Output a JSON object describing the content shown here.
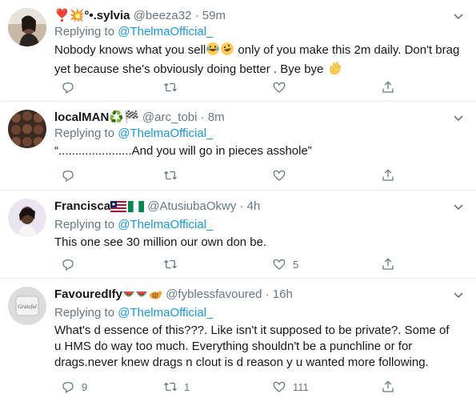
{
  "tweets": [
    {
      "name": "❣️💥°•.sylvia",
      "handle": "@beeza32",
      "time": "59m",
      "replying_label": "Replying to",
      "replying_to": "@ThelmaOfficial_",
      "text_a": "Nobody knows what you sell",
      "text_b": " only of you make this 2m daily.  Don't brag yet because she's obviously doing better . Bye bye ",
      "reply_count": "",
      "retweet_count": "",
      "like_count": ""
    },
    {
      "name": "localMAN♻️🏁",
      "handle": "@arc_tobi",
      "time": "8m",
      "replying_label": "Replying to",
      "replying_to": "@ThelmaOfficial_",
      "text": "“......................And you will go in pieces asshole”",
      "reply_count": "",
      "retweet_count": "",
      "like_count": ""
    },
    {
      "name": "Francisca",
      "handle": "@AtusiubaOkwy",
      "time": "4h",
      "replying_label": "Replying to",
      "replying_to": "@ThelmaOfficial_",
      "text": "This one see 30 million our own don be.",
      "reply_count": "",
      "retweet_count": "",
      "like_count": "5"
    },
    {
      "name": "FavouredIfy",
      "handle": "@fyblessfavoured",
      "time": "16h",
      "replying_label": "Replying to",
      "replying_to": "@ThelmaOfficial_",
      "text": "What's d essence of this???. Like isn't it supposed to be private?. Some of u HMS do way too much. Everything shouldn't be a punchline or for drags.never knew drags n clout is d reason y u wanted more following.",
      "reply_count": "9",
      "retweet_count": "1",
      "like_count": "111"
    }
  ],
  "separator": "·",
  "avatar_text_4": "Grateful",
  "icons": [
    "reply-icon",
    "retweet-icon",
    "like-icon",
    "share-icon",
    "chevron-down-icon"
  ],
  "colors": {
    "accent": "#1b95e0",
    "muted": "#657786",
    "border": "#e6ecf0"
  }
}
